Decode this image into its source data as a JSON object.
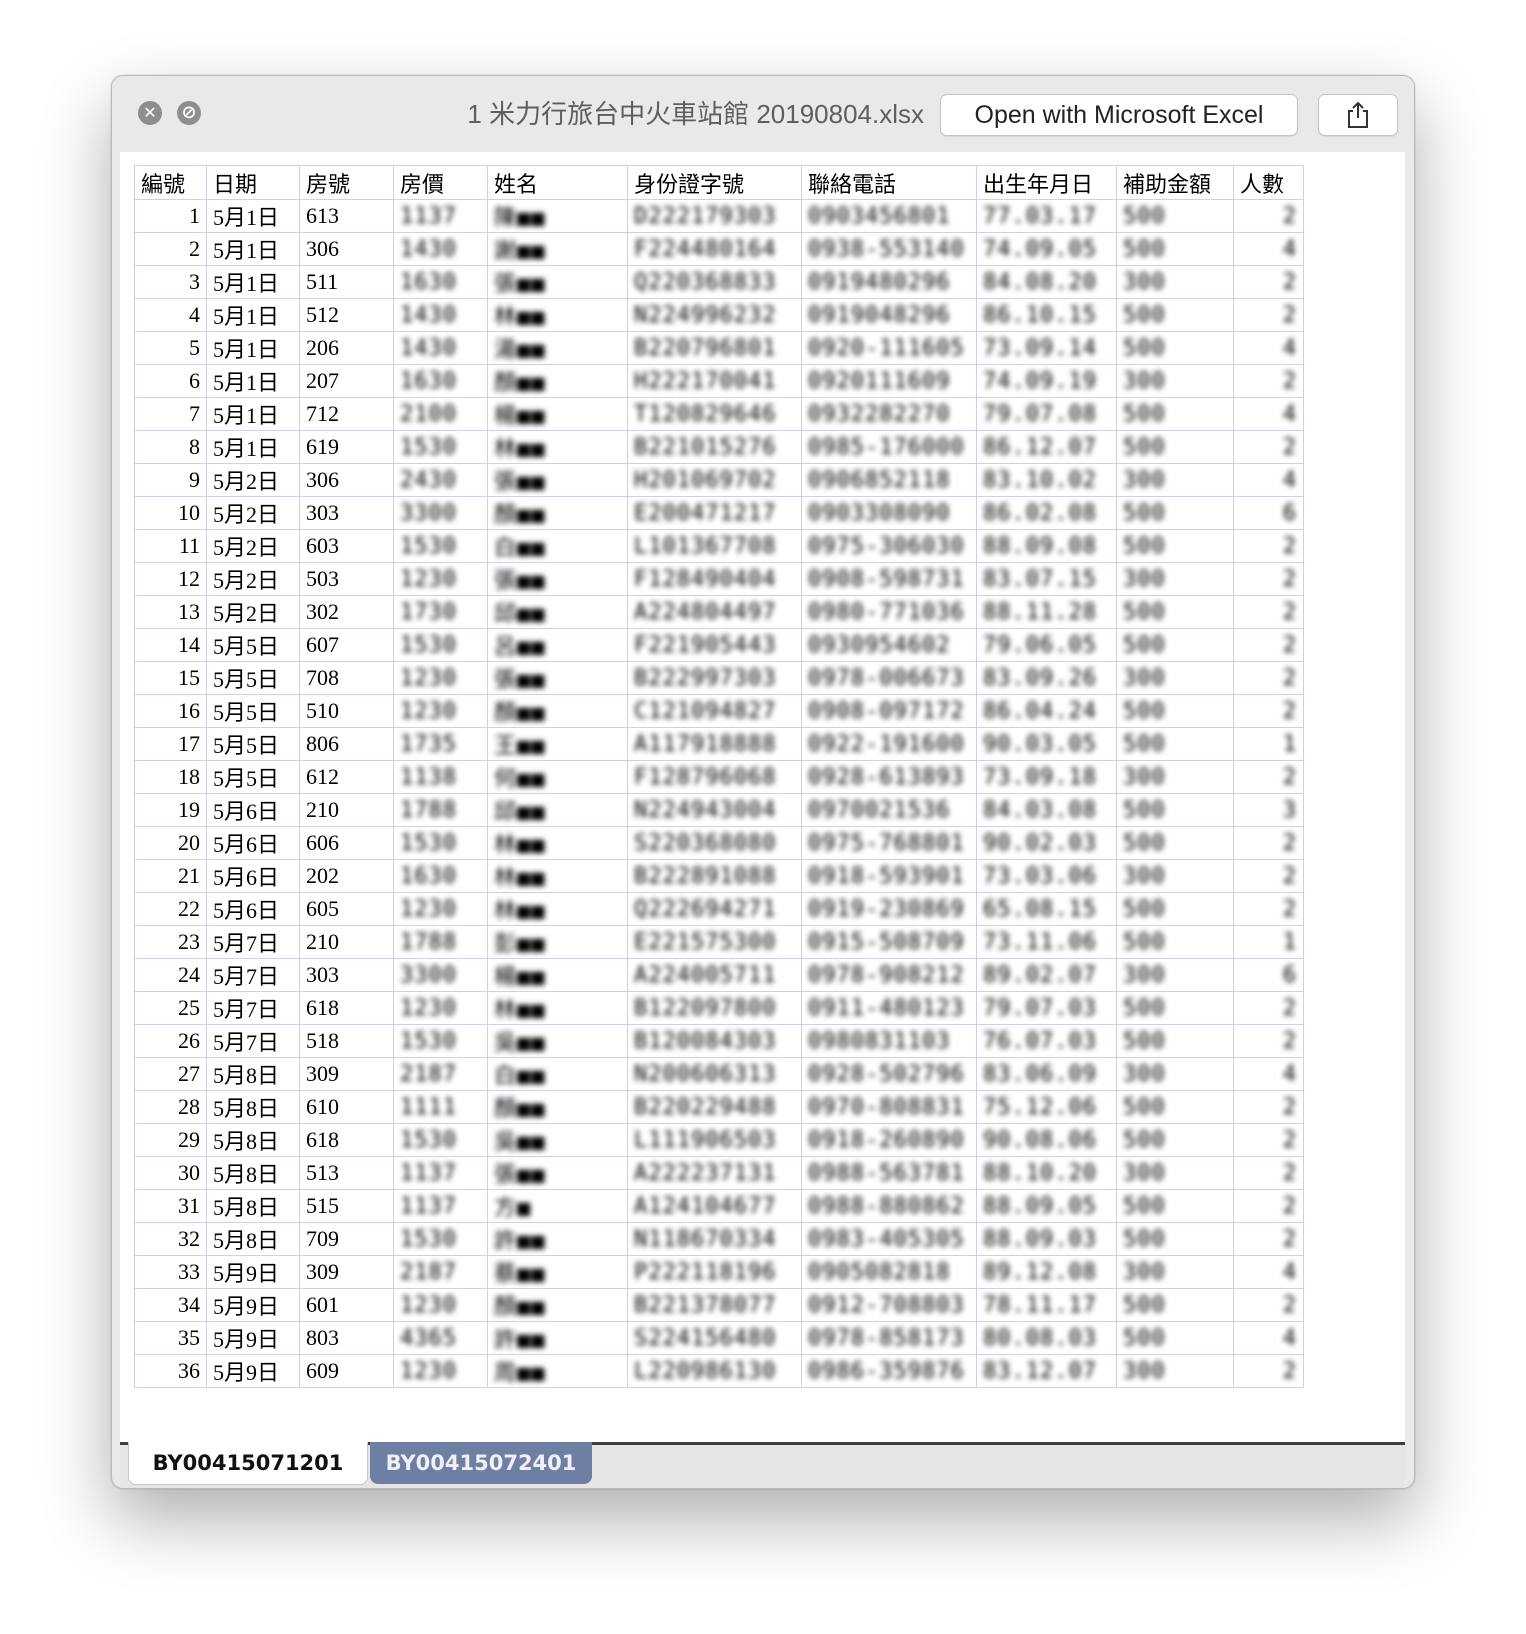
{
  "window": {
    "title": "1 米力行旅台中火車站館 20190804.xlsx",
    "open_button": "Open with Microsoft Excel",
    "close_icon": "close-icon",
    "minimize_icon": "minimize-icon",
    "share_icon": "share-icon"
  },
  "table": {
    "headers": [
      "編號",
      "日期",
      "房號",
      "房價",
      "姓名",
      "身份證字號",
      "聯絡電話",
      "出生年月日",
      "補助金額",
      "人數"
    ],
    "rows": [
      {
        "no": "1",
        "date": "5月1日",
        "room": "613",
        "price": "1137",
        "name": "陳■■",
        "id": "D222179303",
        "phone": "0903456801",
        "birth": "77.03.17",
        "subsidy": "500",
        "people": "2"
      },
      {
        "no": "2",
        "date": "5月1日",
        "room": "306",
        "price": "1430",
        "name": "謝■■",
        "id": "F224480164",
        "phone": "0938-553140",
        "birth": "74.09.05",
        "subsidy": "500",
        "people": "4"
      },
      {
        "no": "3",
        "date": "5月1日",
        "room": "511",
        "price": "1630",
        "name": "張■■",
        "id": "Q220368833",
        "phone": "0919480296",
        "birth": "84.08.20",
        "subsidy": "300",
        "people": "2"
      },
      {
        "no": "4",
        "date": "5月1日",
        "room": "512",
        "price": "1430",
        "name": "林■■",
        "id": "N224996232",
        "phone": "0919048296",
        "birth": "86.10.15",
        "subsidy": "500",
        "people": "2"
      },
      {
        "no": "5",
        "date": "5月1日",
        "room": "206",
        "price": "1430",
        "name": "湯■■",
        "id": "B220796801",
        "phone": "0920-111605",
        "birth": "73.09.14",
        "subsidy": "500",
        "people": "4"
      },
      {
        "no": "6",
        "date": "5月1日",
        "room": "207",
        "price": "1630",
        "name": "顏■■",
        "id": "H222170041",
        "phone": "0920111609",
        "birth": "74.09.19",
        "subsidy": "300",
        "people": "2"
      },
      {
        "no": "7",
        "date": "5月1日",
        "room": "712",
        "price": "2100",
        "name": "楊■■",
        "id": "T120829646",
        "phone": "0932282270",
        "birth": "79.07.08",
        "subsidy": "500",
        "people": "4"
      },
      {
        "no": "8",
        "date": "5月1日",
        "room": "619",
        "price": "1530",
        "name": "林■■",
        "id": "B221015276",
        "phone": "0985-176000",
        "birth": "86.12.07",
        "subsidy": "500",
        "people": "2"
      },
      {
        "no": "9",
        "date": "5月2日",
        "room": "306",
        "price": "2430",
        "name": "張■■",
        "id": "H201069702",
        "phone": "0906852118",
        "birth": "83.10.02",
        "subsidy": "300",
        "people": "4"
      },
      {
        "no": "10",
        "date": "5月2日",
        "room": "303",
        "price": "3300",
        "name": "顏■■",
        "id": "E200471217",
        "phone": "0903308090",
        "birth": "86.02.08",
        "subsidy": "500",
        "people": "6"
      },
      {
        "no": "11",
        "date": "5月2日",
        "room": "603",
        "price": "1530",
        "name": "白■■",
        "id": "L101367708",
        "phone": "0975-306030",
        "birth": "88.09.08",
        "subsidy": "500",
        "people": "2"
      },
      {
        "no": "12",
        "date": "5月2日",
        "room": "503",
        "price": "1230",
        "name": "張■■",
        "id": "F128490404",
        "phone": "0908-598731",
        "birth": "83.07.15",
        "subsidy": "300",
        "people": "2"
      },
      {
        "no": "13",
        "date": "5月2日",
        "room": "302",
        "price": "1730",
        "name": "邱■■",
        "id": "A224804497",
        "phone": "0980-771036",
        "birth": "88.11.28",
        "subsidy": "500",
        "people": "2"
      },
      {
        "no": "14",
        "date": "5月5日",
        "room": "607",
        "price": "1530",
        "name": "呂■■",
        "id": "F221905443",
        "phone": "0930954602",
        "birth": "79.06.05",
        "subsidy": "500",
        "people": "2"
      },
      {
        "no": "15",
        "date": "5月5日",
        "room": "708",
        "price": "1230",
        "name": "張■■",
        "id": "B222997303",
        "phone": "0978-006673",
        "birth": "83.09.26",
        "subsidy": "300",
        "people": "2"
      },
      {
        "no": "16",
        "date": "5月5日",
        "room": "510",
        "price": "1230",
        "name": "顏■■",
        "id": "C121094827",
        "phone": "0908-097172",
        "birth": "86.04.24",
        "subsidy": "500",
        "people": "2"
      },
      {
        "no": "17",
        "date": "5月5日",
        "room": "806",
        "price": "1735",
        "name": "王■■",
        "id": "A117918888",
        "phone": "0922-191600",
        "birth": "90.03.05",
        "subsidy": "500",
        "people": "1"
      },
      {
        "no": "18",
        "date": "5月5日",
        "room": "612",
        "price": "1138",
        "name": "何■■",
        "id": "F128796068",
        "phone": "0928-613893",
        "birth": "73.09.18",
        "subsidy": "300",
        "people": "2"
      },
      {
        "no": "19",
        "date": "5月6日",
        "room": "210",
        "price": "1788",
        "name": "邱■■",
        "id": "N224943004",
        "phone": "0970021536",
        "birth": "84.03.08",
        "subsidy": "500",
        "people": "3"
      },
      {
        "no": "20",
        "date": "5月6日",
        "room": "606",
        "price": "1530",
        "name": "林■■",
        "id": "S220368080",
        "phone": "0975-768801",
        "birth": "90.02.03",
        "subsidy": "500",
        "people": "2"
      },
      {
        "no": "21",
        "date": "5月6日",
        "room": "202",
        "price": "1630",
        "name": "林■■",
        "id": "B222891088",
        "phone": "0918-593901",
        "birth": "73.03.06",
        "subsidy": "300",
        "people": "2"
      },
      {
        "no": "22",
        "date": "5月6日",
        "room": "605",
        "price": "1230",
        "name": "林■■",
        "id": "Q222694271",
        "phone": "0919-230869",
        "birth": "65.08.15",
        "subsidy": "500",
        "people": "2"
      },
      {
        "no": "23",
        "date": "5月7日",
        "room": "210",
        "price": "1788",
        "name": "彭■■",
        "id": "E221575300",
        "phone": "0915-508709",
        "birth": "73.11.06",
        "subsidy": "500",
        "people": "1"
      },
      {
        "no": "24",
        "date": "5月7日",
        "room": "303",
        "price": "3300",
        "name": "楊■■",
        "id": "A224005711",
        "phone": "0978-908212",
        "birth": "89.02.07",
        "subsidy": "300",
        "people": "6"
      },
      {
        "no": "25",
        "date": "5月7日",
        "room": "618",
        "price": "1230",
        "name": "林■■",
        "id": "B122097800",
        "phone": "0911-480123",
        "birth": "79.07.03",
        "subsidy": "500",
        "people": "2"
      },
      {
        "no": "26",
        "date": "5月7日",
        "room": "518",
        "price": "1530",
        "name": "吳■■",
        "id": "B120084303",
        "phone": "0980831103",
        "birth": "76.07.03",
        "subsidy": "500",
        "people": "2"
      },
      {
        "no": "27",
        "date": "5月8日",
        "room": "309",
        "price": "2187",
        "name": "白■■",
        "id": "N200606313",
        "phone": "0928-502796",
        "birth": "83.06.09",
        "subsidy": "300",
        "people": "4"
      },
      {
        "no": "28",
        "date": "5月8日",
        "room": "610",
        "price": "1111",
        "name": "顏■■",
        "id": "B220229488",
        "phone": "0970-808831",
        "birth": "75.12.06",
        "subsidy": "500",
        "people": "2"
      },
      {
        "no": "29",
        "date": "5月8日",
        "room": "618",
        "price": "1530",
        "name": "吳■■",
        "id": "L111906503",
        "phone": "0918-260890",
        "birth": "90.08.06",
        "subsidy": "500",
        "people": "2"
      },
      {
        "no": "30",
        "date": "5月8日",
        "room": "513",
        "price": "1137",
        "name": "張■■",
        "id": "A222237131",
        "phone": "0988-563781",
        "birth": "88.10.20",
        "subsidy": "300",
        "people": "2"
      },
      {
        "no": "31",
        "date": "5月8日",
        "room": "515",
        "price": "1137",
        "name": "方■",
        "id": "A124104677",
        "phone": "0988-880862",
        "birth": "88.09.05",
        "subsidy": "500",
        "people": "2"
      },
      {
        "no": "32",
        "date": "5月8日",
        "room": "709",
        "price": "1530",
        "name": "許■■",
        "id": "N118670334",
        "phone": "0983-405305",
        "birth": "88.09.03",
        "subsidy": "500",
        "people": "2"
      },
      {
        "no": "33",
        "date": "5月9日",
        "room": "309",
        "price": "2187",
        "name": "蔡■■",
        "id": "P222118196",
        "phone": "0905082818",
        "birth": "89.12.08",
        "subsidy": "300",
        "people": "4"
      },
      {
        "no": "34",
        "date": "5月9日",
        "room": "601",
        "price": "1230",
        "name": "顏■■",
        "id": "B221378077",
        "phone": "0912-708803",
        "birth": "78.11.17",
        "subsidy": "500",
        "people": "2"
      },
      {
        "no": "35",
        "date": "5月9日",
        "room": "803",
        "price": "4365",
        "name": "許■■",
        "id": "S224156480",
        "phone": "0978-858173",
        "birth": "80.08.03",
        "subsidy": "500",
        "people": "4"
      },
      {
        "no": "36",
        "date": "5月9日",
        "room": "609",
        "price": "1230",
        "name": "周■■",
        "id": "L220986130",
        "phone": "0986-359876",
        "birth": "83.12.07",
        "subsidy": "300",
        "people": "2"
      }
    ]
  },
  "sheets": {
    "tab1": "BY00415071201",
    "tab2": "BY00415072401"
  }
}
